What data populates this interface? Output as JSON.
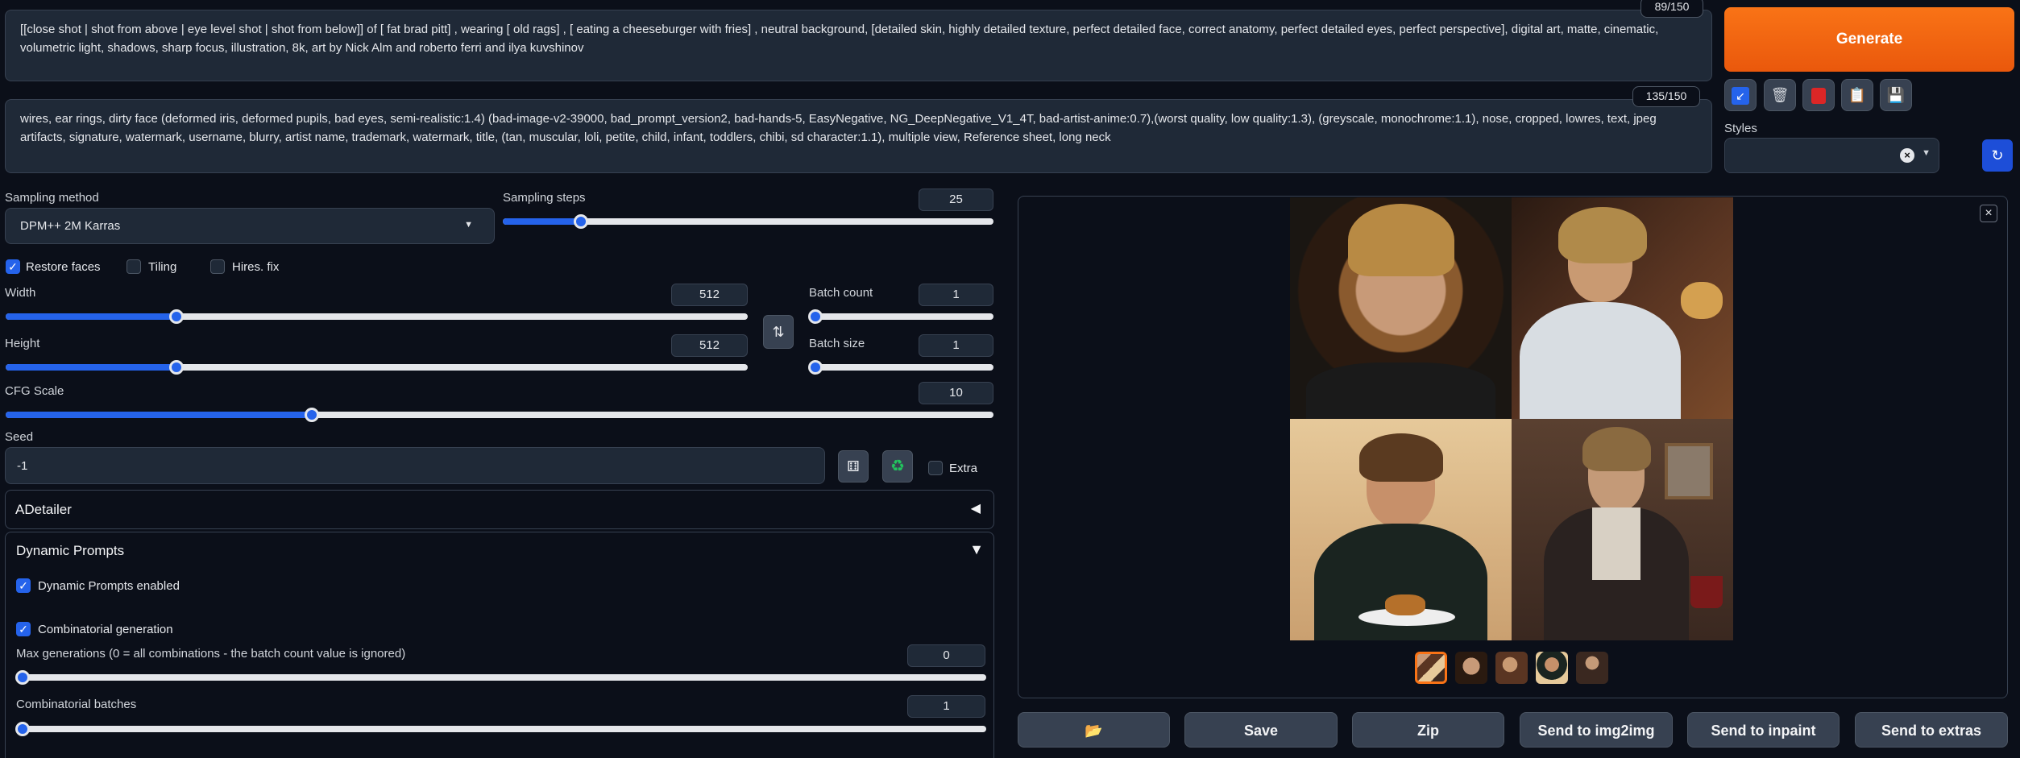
{
  "prompt": {
    "text": "[[close shot | shot from above | eye level shot | shot from below]] of [ fat brad pitt] ,  wearing [ old rags] , [ eating a cheeseburger with fries] ,  neutral background,  [detailed skin, highly detailed texture,  perfect detailed face,  correct anatomy, perfect detailed eyes, perfect perspective],  digital art, matte, cinematic, volumetric light,  shadows,   sharp focus, illustration,  8k, art by Nick Alm  and roberto ferri and ilya kuvshinov",
    "counter": "89/150"
  },
  "negative_prompt": {
    "text": "wires, ear rings, dirty face (deformed iris, deformed pupils, bad eyes, semi-realistic:1.4) (bad-image-v2-39000, bad_prompt_version2, bad-hands-5, EasyNegative, NG_DeepNegative_V1_4T, bad-artist-anime:0.7),(worst quality, low quality:1.3), (greyscale, monochrome:1.1), nose, cropped, lowres, text, jpeg artifacts, signature, watermark, username, blurry, artist name, trademark, watermark, title, (tan, muscular, loli, petite, child, infant, toddlers, chibi, sd character:1.1), multiple view, Reference sheet, long neck",
    "counter": "135/150"
  },
  "generate_label": "Generate",
  "styles": {
    "label": "Styles",
    "value": ""
  },
  "sampling": {
    "method_label": "Sampling method",
    "method_value": "DPM++ 2M Karras",
    "steps_label": "Sampling steps",
    "steps_value": "25",
    "steps_fraction": 0.16
  },
  "checkboxes": {
    "restore_faces": "Restore faces",
    "tiling": "Tiling",
    "hires_fix": "Hires. fix"
  },
  "width": {
    "label": "Width",
    "value": "512",
    "fraction": 0.23
  },
  "height": {
    "label": "Height",
    "value": "512",
    "fraction": 0.23
  },
  "batch_count": {
    "label": "Batch count",
    "value": "1",
    "fraction": 0.0
  },
  "batch_size": {
    "label": "Batch size",
    "value": "1",
    "fraction": 0.0
  },
  "cfg": {
    "label": "CFG Scale",
    "value": "10",
    "fraction": 0.31
  },
  "seed": {
    "label": "Seed",
    "value": "-1",
    "extra_label": "Extra"
  },
  "adetailer": {
    "title": "ADetailer"
  },
  "dynamic_prompts": {
    "title": "Dynamic Prompts",
    "enabled_label": "Dynamic Prompts enabled",
    "combinatorial_label": "Combinatorial generation",
    "max_gen_label": "Max generations (0 = all combinations - the batch count value is ignored)",
    "max_gen_value": "0",
    "comb_batches_label": "Combinatorial batches",
    "comb_batches_value": "1"
  },
  "output_buttons": {
    "folder": "📂",
    "save": "Save",
    "zip": "Zip",
    "img2img": "Send to img2img",
    "inpaint": "Send to inpaint",
    "extras": "Send to extras"
  },
  "colors": {
    "accent": "#ea580c",
    "slider": "#2563eb",
    "background": "#0b0f19"
  }
}
